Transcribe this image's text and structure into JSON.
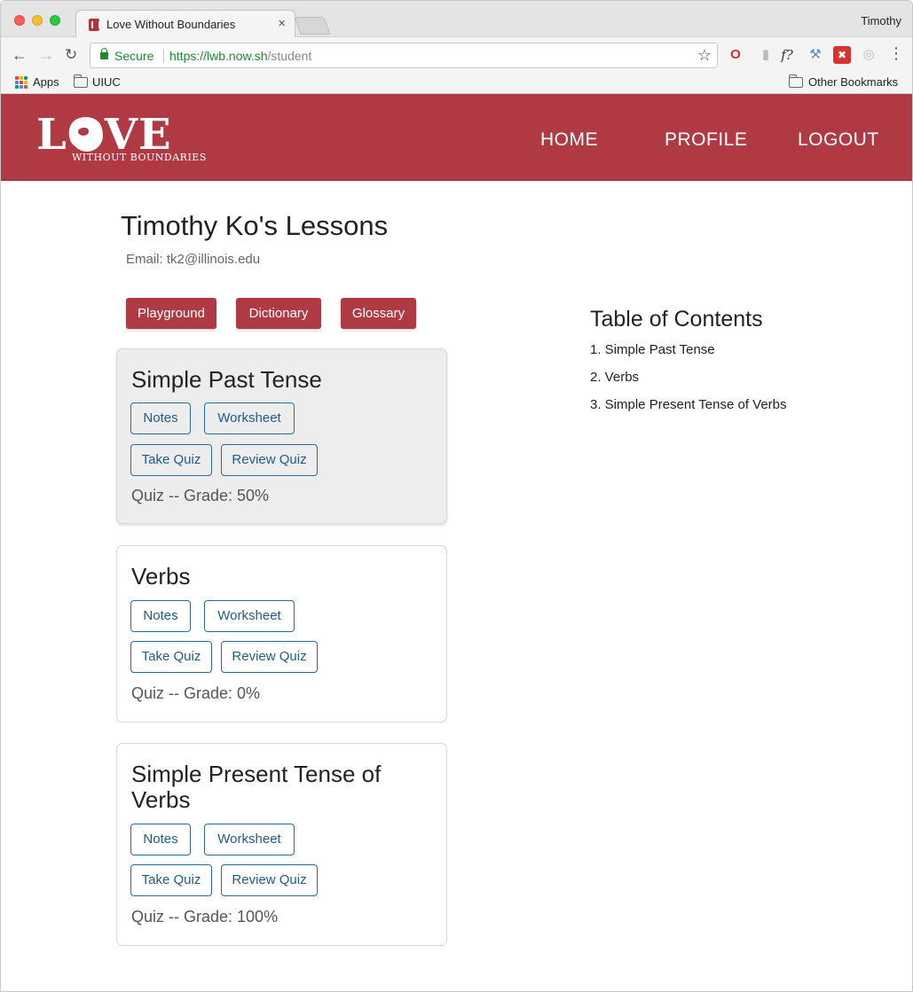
{
  "browser": {
    "tab_title": "Love Without Boundaries",
    "tab_close": "×",
    "profile": "Timothy",
    "nav": {
      "back": "←",
      "forward": "→",
      "reload": "↻"
    },
    "secure_label": "Secure",
    "url": {
      "scheme": "https://",
      "host": "lwb.now.sh",
      "path": "/student"
    },
    "bookmarks": [
      {
        "label": "Apps"
      },
      {
        "label": "UIUC"
      },
      {
        "label": "Other Bookmarks"
      }
    ],
    "apps_colors": [
      "#e04a3f",
      "#f4b400",
      "#0f9d58",
      "#4285f4",
      "#db4437",
      "#f4b400",
      "#0f9d58",
      "#4285f4",
      "#e04a3f"
    ],
    "extensions": [
      "opera-icon",
      "gray-extension-icon",
      "f-formula-icon",
      "tools-icon",
      "red-extension-icon",
      "circle-extension-icon"
    ]
  },
  "site": {
    "logo_word": "LOVE",
    "logo_sub": "WITHOUT BOUNDARIES",
    "nav": [
      {
        "label": "HOME"
      },
      {
        "label": "PROFILE"
      },
      {
        "label": "LOGOUT"
      }
    ],
    "brand_color": "#b03a44"
  },
  "page": {
    "title": "Timothy Ko's Lessons",
    "email": "Email: tk2@illinois.edu",
    "tools": [
      {
        "label": "Playground"
      },
      {
        "label": "Dictionary"
      },
      {
        "label": "Glossary"
      }
    ]
  },
  "lessons": [
    {
      "title": "Simple Past Tense",
      "notes": "Notes",
      "worksheet": "Worksheet",
      "take_quiz": "Take Quiz",
      "review_quiz": "Review Quiz",
      "grade": "Quiz -- Grade: 50%"
    },
    {
      "title": "Verbs",
      "notes": "Notes",
      "worksheet": "Worksheet",
      "take_quiz": "Take Quiz",
      "review_quiz": "Review Quiz",
      "grade": "Quiz -- Grade: 0%"
    },
    {
      "title": "Simple Present Tense of Verbs",
      "notes": "Notes",
      "worksheet": "Worksheet",
      "take_quiz": "Take Quiz",
      "review_quiz": "Review Quiz",
      "grade": "Quiz -- Grade: 100%"
    }
  ],
  "toc": {
    "title": "Table of Contents",
    "items": [
      "1. Simple Past Tense",
      "2. Verbs",
      "3. Simple Present Tense of Verbs"
    ]
  }
}
